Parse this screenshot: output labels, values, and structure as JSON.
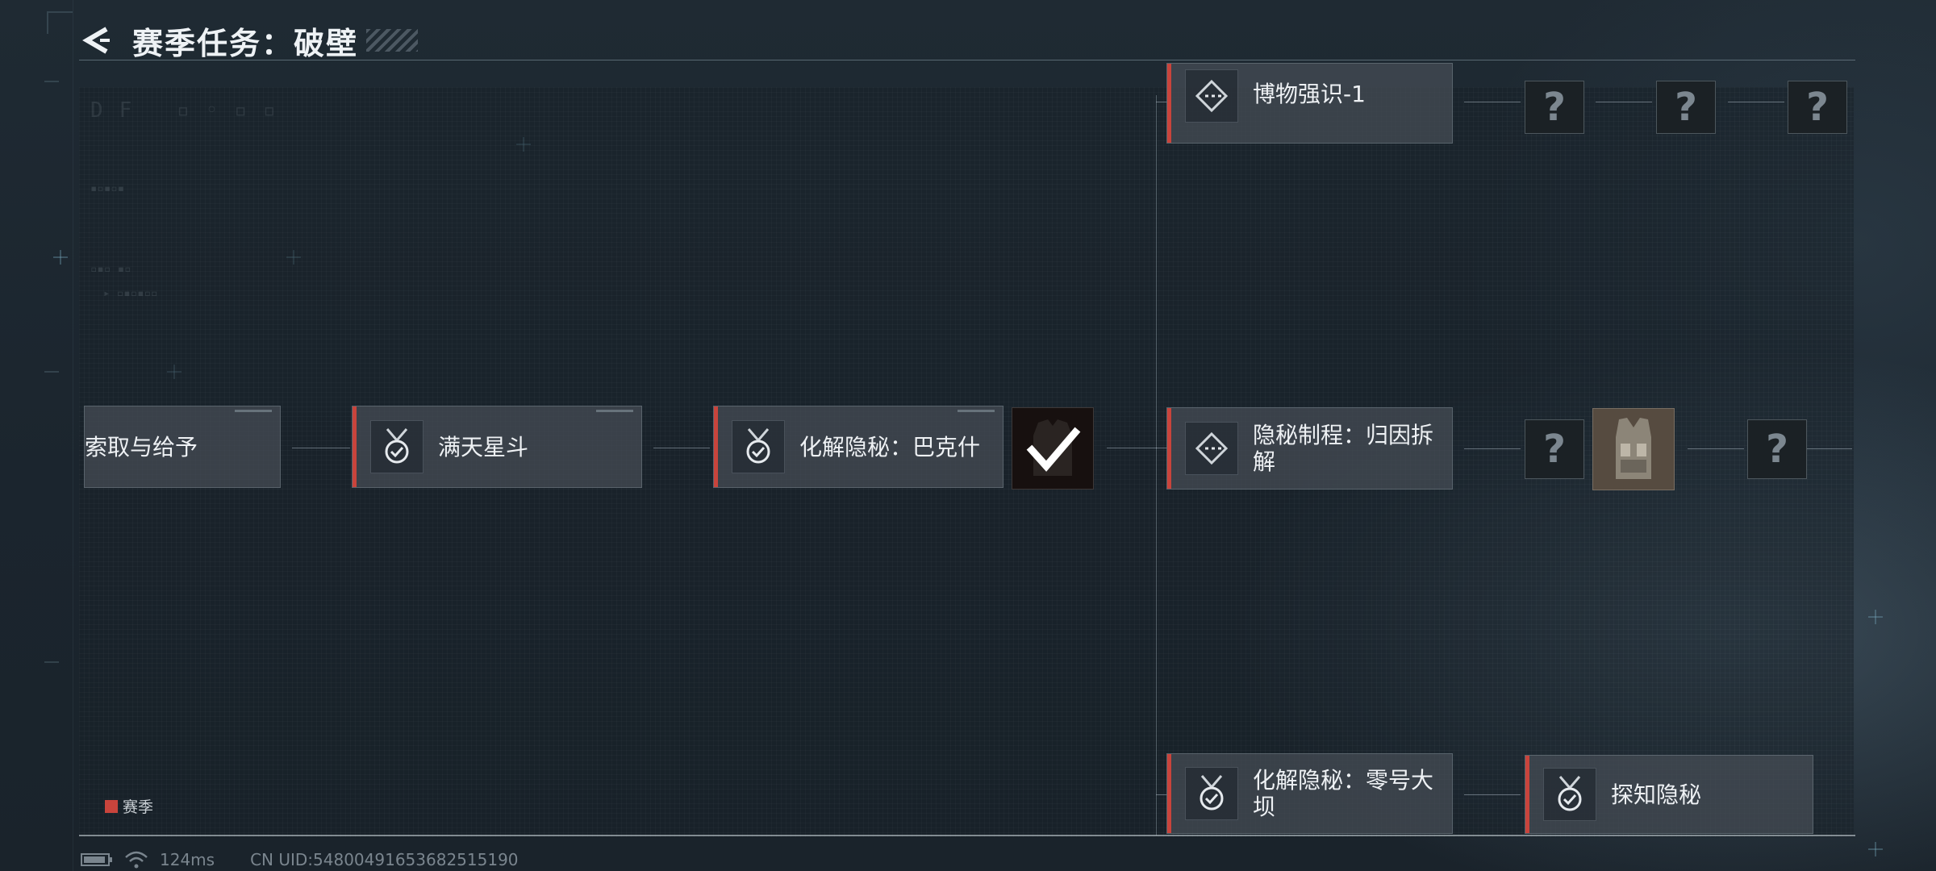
{
  "header": {
    "title": "赛季任务：破壁"
  },
  "nodes": {
    "n1": {
      "label": "索取与给予"
    },
    "n2": {
      "label": "满天星斗"
    },
    "n3": {
      "label": "化解隐秘：巴克什"
    },
    "n4": {
      "label": "博物强识-1"
    },
    "n5": {
      "label": "隐秘制程：归因拆解"
    },
    "n6": {
      "label": "化解隐秘：零号大坝"
    },
    "n7": {
      "label": "探知隐秘"
    }
  },
  "mystery_symbol": "?",
  "legend": {
    "label": "赛季",
    "color": "#c9443c"
  },
  "status": {
    "ping": "124ms",
    "uid": "CN UID:5480049165368251519​0"
  },
  "colors": {
    "accent": "#c9443c",
    "background": "#1f2a33"
  }
}
